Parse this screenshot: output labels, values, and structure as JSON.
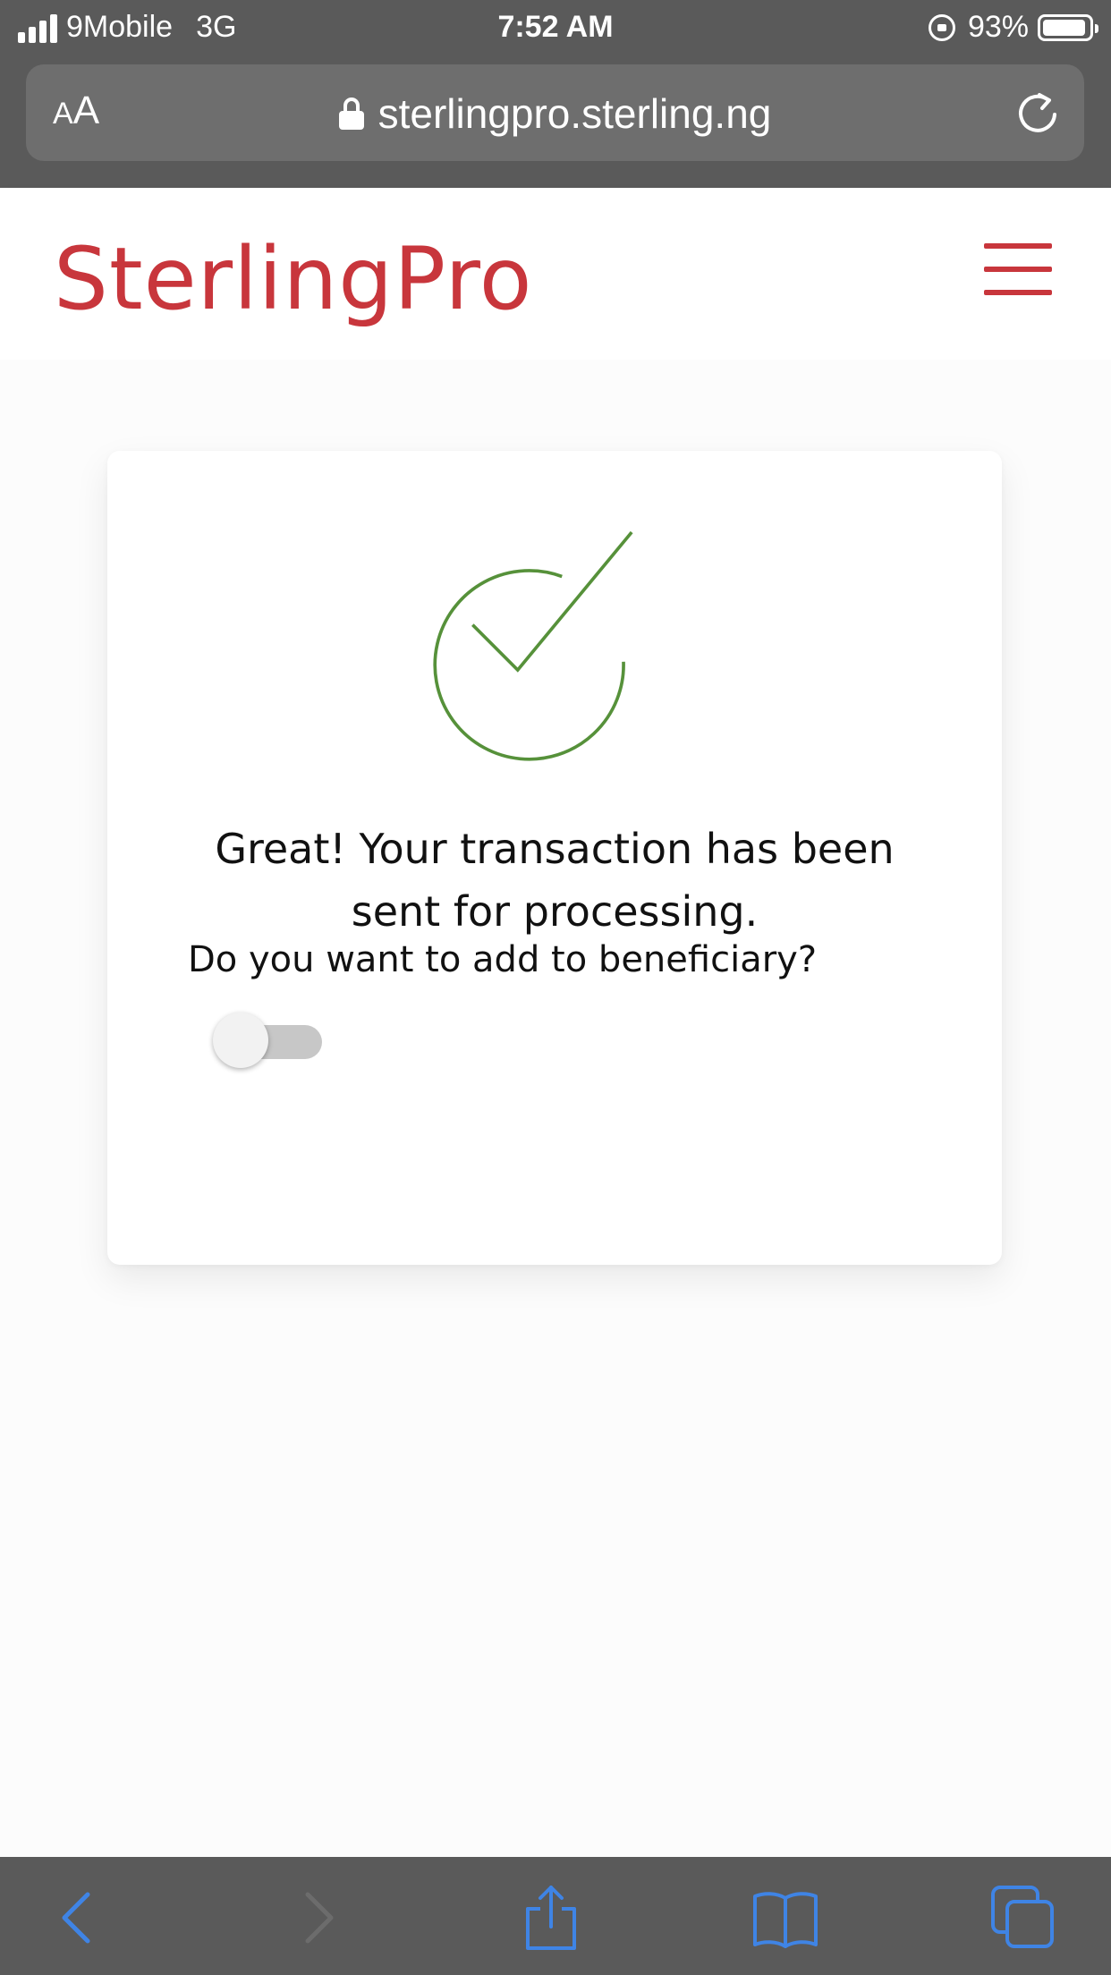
{
  "status_bar": {
    "carrier": "9Mobile",
    "network": "3G",
    "time": "7:52 AM",
    "battery_percent": "93%",
    "battery_level": 0.93,
    "signal_bars": 4
  },
  "browser": {
    "text_size_label_small": "A",
    "text_size_label_large": "A",
    "url": "sterlingpro.sterling.ng"
  },
  "site": {
    "logo": "SterlingPro",
    "brand_color": "#c8363c"
  },
  "card": {
    "success_line_1": "Great! Your transaction has been",
    "success_line_2": "sent for processing.",
    "beneficiary_question": "Do you want to add to beneficiary?",
    "add_beneficiary_toggle_on": false,
    "check_color": "#56913a"
  },
  "toolbar": {
    "icons": [
      "back-icon",
      "forward-icon",
      "share-icon",
      "bookmarks-icon",
      "tabs-icon"
    ],
    "active_color": "#3f84e5",
    "disabled_color": "#6c6c6c"
  }
}
